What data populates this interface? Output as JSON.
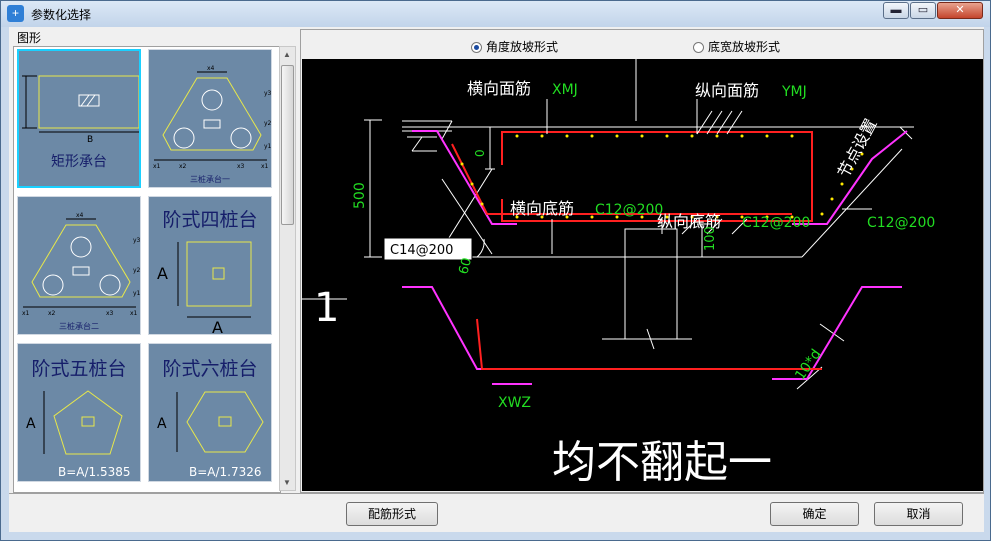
{
  "window": {
    "title": "参数化选择",
    "controls": {
      "minimize": "▬",
      "maximize": "▭",
      "close": "✕"
    }
  },
  "left_panel": {
    "label": "图形",
    "thumbnails": [
      {
        "caption": "矩形承台",
        "dim": "B",
        "selected": true
      },
      {
        "caption": "三桩承台一",
        "dims": [
          "x4",
          "y3",
          "y2",
          "y1",
          "x1",
          "x2",
          "x3",
          "x1"
        ]
      },
      {
        "caption": "三桩承台二",
        "dims": [
          "x4",
          "y3",
          "y2",
          "y1",
          "x1",
          "x2",
          "x3",
          "x1"
        ]
      },
      {
        "caption": "阶式四桩台",
        "dims": [
          "A",
          "A"
        ]
      },
      {
        "caption": "阶式五桩台",
        "dims": [
          "A"
        ],
        "formula": "B=A/1.5385"
      },
      {
        "caption": "阶式六桩台",
        "dims": [
          "A"
        ],
        "formula": "B=A/1.7326"
      }
    ]
  },
  "options": {
    "angle_slope": "角度放坡形式",
    "width_slope": "底宽放坡形式",
    "selected": "angle_slope"
  },
  "drawing": {
    "transverse_top": "横向面筋",
    "transverse_top_code": "XMJ",
    "longitudinal_top": "纵向面筋",
    "longitudinal_top_code": "YMJ",
    "node_setting": "节点设置",
    "transverse_bottom": "横向底筋",
    "transverse_bottom_value": "C12@200",
    "longitudinal_bottom": "纵向底筋",
    "longitudinal_bottom_value": "C12@200",
    "right_value": "C12@200",
    "slope_rebar": "C14@200",
    "height": "500",
    "top_gap": "0",
    "angle": "60",
    "bottom_gap": "100",
    "section_mark": "1",
    "lap_length": "10*d",
    "xwz": "XWZ",
    "note": "均不翻起一"
  },
  "buttons": {
    "rebar_form": "配筋形式",
    "ok": "确定",
    "cancel": "取消"
  },
  "colors": {
    "canvas_bg": "#000000",
    "rebar_red": "#ff2020",
    "outline_magenta": "#ff33ff",
    "label_green": "#22dd22",
    "thumb_bg": "#6c89a6",
    "selection": "#1ad0ff"
  }
}
